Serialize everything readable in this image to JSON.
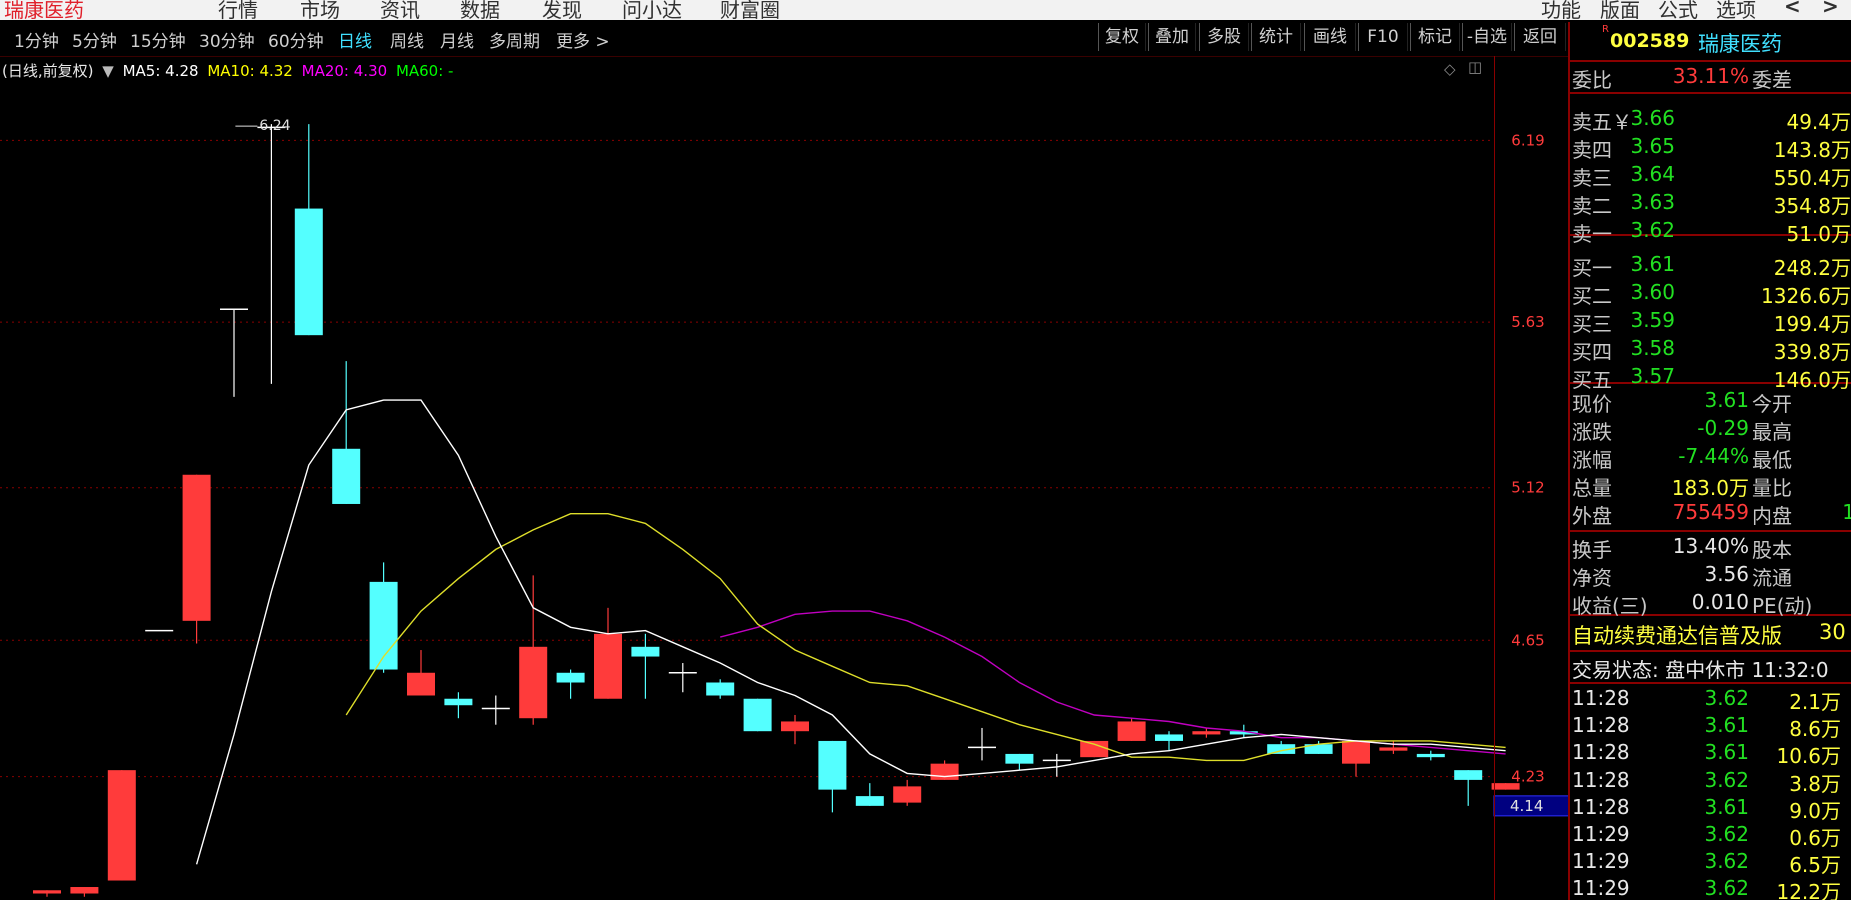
{
  "menubar": {
    "app_title": "瑞康医药",
    "items": [
      "行情",
      "市场",
      "资讯",
      "数据",
      "发现",
      "问小达",
      "财富圈"
    ],
    "right_items": [
      "功能",
      "版面",
      "公式",
      "选项"
    ],
    "nav_back": "<",
    "nav_forward": ">"
  },
  "periods": [
    {
      "label": "1分钟",
      "active": false
    },
    {
      "label": "5分钟",
      "active": false
    },
    {
      "label": "15分钟",
      "active": false
    },
    {
      "label": "30分钟",
      "active": false
    },
    {
      "label": "60分钟",
      "active": false
    },
    {
      "label": "日线",
      "active": true
    },
    {
      "label": "周线",
      "active": false
    },
    {
      "label": "月线",
      "active": false
    },
    {
      "label": "多周期",
      "active": false
    },
    {
      "label": "更多",
      "active": false
    }
  ],
  "more_arrow": ">",
  "tools": [
    "复权",
    "叠加",
    "多股",
    "统计",
    "画线",
    "F10",
    "标记",
    "-自选",
    "返回"
  ],
  "legend": {
    "label": "(日线,前复权)",
    "ma5": "MA5: 4.28",
    "ma10": "MA10: 4.32",
    "ma20": "MA20: 4.30",
    "ma60": "MA60: -",
    "colors": {
      "ma5": "#ffffff",
      "ma10": "#ffff00",
      "ma20": "#ff00ff",
      "ma60": "#00ff00"
    }
  },
  "chart_data": {
    "type": "candlestick",
    "y_ticks": [
      "6.19",
      "5.63",
      "5.12",
      "4.65",
      "4.23"
    ],
    "high_label": "6.24",
    "current_price_tag": "4.14",
    "ylim": [
      3.85,
      6.45
    ],
    "colors": {
      "up": "#ff3b3b",
      "down": "#54ffff",
      "ma5": "#ffffff",
      "ma10": "#dede2a",
      "ma20": "#c000c0"
    },
    "candles": [
      {
        "o": 3.87,
        "c": 3.88,
        "h": 3.88,
        "l": 3.86
      },
      {
        "o": 3.87,
        "c": 3.89,
        "h": 3.89,
        "l": 3.86
      },
      {
        "o": 3.91,
        "c": 4.25,
        "h": 4.25,
        "l": 3.91
      },
      {
        "o": 4.68,
        "c": 4.68,
        "h": 4.68,
        "l": 4.68
      },
      {
        "o": 4.71,
        "c": 5.16,
        "h": 5.16,
        "l": 4.64
      },
      {
        "o": 5.67,
        "c": 5.67,
        "h": 5.67,
        "l": 5.4
      },
      {
        "o": 6.23,
        "c": 6.23,
        "h": 6.24,
        "l": 5.44
      },
      {
        "o": 5.98,
        "c": 5.59,
        "h": 6.24,
        "l": 5.59
      },
      {
        "o": 5.24,
        "c": 5.07,
        "h": 5.51,
        "l": 5.07
      },
      {
        "o": 4.83,
        "c": 4.56,
        "h": 4.89,
        "l": 4.55
      },
      {
        "o": 4.48,
        "c": 4.55,
        "h": 4.62,
        "l": 4.48
      },
      {
        "o": 4.47,
        "c": 4.45,
        "h": 4.49,
        "l": 4.41
      },
      {
        "o": 4.44,
        "c": 4.44,
        "h": 4.48,
        "l": 4.39
      },
      {
        "o": 4.41,
        "c": 4.63,
        "h": 4.85,
        "l": 4.39
      },
      {
        "o": 4.55,
        "c": 4.52,
        "h": 4.56,
        "l": 4.47
      },
      {
        "o": 4.47,
        "c": 4.67,
        "h": 4.75,
        "l": 4.47
      },
      {
        "o": 4.63,
        "c": 4.6,
        "h": 4.67,
        "l": 4.47
      },
      {
        "o": 4.55,
        "c": 4.55,
        "h": 4.58,
        "l": 4.49
      },
      {
        "o": 4.52,
        "c": 4.48,
        "h": 4.53,
        "l": 4.47
      },
      {
        "o": 4.47,
        "c": 4.37,
        "h": 4.47,
        "l": 4.37
      },
      {
        "o": 4.37,
        "c": 4.4,
        "h": 4.42,
        "l": 4.33
      },
      {
        "o": 4.34,
        "c": 4.19,
        "h": 4.34,
        "l": 4.12
      },
      {
        "o": 4.17,
        "c": 4.14,
        "h": 4.21,
        "l": 4.14
      },
      {
        "o": 4.15,
        "c": 4.2,
        "h": 4.22,
        "l": 4.14
      },
      {
        "o": 4.22,
        "c": 4.27,
        "h": 4.28,
        "l": 4.22
      },
      {
        "o": 4.32,
        "c": 4.32,
        "h": 4.38,
        "l": 4.28
      },
      {
        "o": 4.3,
        "c": 4.27,
        "h": 4.3,
        "l": 4.25
      },
      {
        "o": 4.28,
        "c": 4.28,
        "h": 4.3,
        "l": 4.23
      },
      {
        "o": 4.29,
        "c": 4.34,
        "h": 4.34,
        "l": 4.29
      },
      {
        "o": 4.34,
        "c": 4.4,
        "h": 4.41,
        "l": 4.34
      },
      {
        "o": 4.36,
        "c": 4.34,
        "h": 4.37,
        "l": 4.31
      },
      {
        "o": 4.36,
        "c": 4.37,
        "h": 4.38,
        "l": 4.35
      },
      {
        "o": 4.37,
        "c": 4.36,
        "h": 4.39,
        "l": 4.35
      },
      {
        "o": 4.33,
        "c": 4.3,
        "h": 4.34,
        "l": 4.3
      },
      {
        "o": 4.33,
        "c": 4.3,
        "h": 4.34,
        "l": 4.3
      },
      {
        "o": 4.27,
        "c": 4.34,
        "h": 4.34,
        "l": 4.23
      },
      {
        "o": 4.31,
        "c": 4.32,
        "h": 4.34,
        "l": 4.3
      },
      {
        "o": 4.3,
        "c": 4.29,
        "h": 4.31,
        "l": 4.28
      },
      {
        "o": 4.25,
        "c": 4.22,
        "h": 4.25,
        "l": 4.14
      },
      {
        "o": 4.19,
        "c": 4.21,
        "h": 4.21,
        "l": 4.19
      }
    ],
    "ma5": [
      null,
      null,
      null,
      null,
      3.96,
      4.36,
      4.8,
      5.19,
      5.36,
      5.39,
      5.39,
      5.22,
      4.97,
      4.75,
      4.69,
      4.67,
      4.68,
      4.63,
      4.58,
      4.52,
      4.48,
      4.42,
      4.3,
      4.24,
      4.23,
      4.24,
      4.25,
      4.26,
      4.28,
      4.3,
      4.31,
      4.33,
      4.35,
      4.36,
      4.35,
      4.34,
      4.33,
      4.33,
      4.32,
      4.31
    ],
    "ma10": [
      null,
      null,
      null,
      null,
      null,
      null,
      null,
      null,
      4.42,
      4.6,
      4.74,
      4.84,
      4.93,
      4.99,
      5.04,
      5.04,
      5.01,
      4.93,
      4.84,
      4.7,
      4.62,
      4.57,
      4.52,
      4.51,
      4.47,
      4.43,
      4.39,
      4.36,
      4.33,
      4.29,
      4.29,
      4.28,
      4.28,
      4.31,
      4.33,
      4.34,
      4.34,
      4.34,
      4.33,
      4.32
    ],
    "ma20": [
      null,
      null,
      null,
      null,
      null,
      null,
      null,
      null,
      null,
      null,
      null,
      null,
      null,
      null,
      null,
      null,
      null,
      null,
      4.66,
      4.69,
      4.73,
      4.74,
      4.74,
      4.71,
      4.66,
      4.6,
      4.52,
      4.46,
      4.42,
      4.41,
      4.4,
      4.38,
      4.37,
      4.35,
      4.35,
      4.34,
      4.33,
      4.32,
      4.31,
      4.3
    ]
  },
  "quote": {
    "code_prefix": "R",
    "code": "002589",
    "name": "瑞康医药",
    "weibi_label": "委比",
    "weibi": "33.11%",
    "weicha_label": "委差",
    "sells": [
      {
        "label": "卖五￥",
        "price": "3.66",
        "vol": "49.4万"
      },
      {
        "label": "卖四",
        "price": "3.65",
        "vol": "143.8万"
      },
      {
        "label": "卖三",
        "price": "3.64",
        "vol": "550.4万"
      },
      {
        "label": "卖二",
        "price": "3.63",
        "vol": "354.8万"
      },
      {
        "label": "卖一",
        "price": "3.62",
        "vol": "51.0万"
      }
    ],
    "buys": [
      {
        "label": "买一",
        "price": "3.61",
        "vol": "248.2万"
      },
      {
        "label": "买二",
        "price": "3.60",
        "vol": "1326.6万"
      },
      {
        "label": "买三",
        "price": "3.59",
        "vol": "199.4万"
      },
      {
        "label": "买四",
        "price": "3.58",
        "vol": "339.8万"
      },
      {
        "label": "买五",
        "price": "3.57",
        "vol": "146.0万"
      }
    ],
    "stats": [
      {
        "label": "现价",
        "value": "3.61",
        "color": "green",
        "label2": "今开"
      },
      {
        "label": "涨跌",
        "value": "-0.29",
        "color": "green",
        "label2": "最高"
      },
      {
        "label": "涨幅",
        "value": "-7.44%",
        "color": "green",
        "label2": "最低"
      },
      {
        "label": "总量",
        "value": "183.0万",
        "color": "yellow",
        "label2": "量比"
      },
      {
        "label": "外盘",
        "value": "755459",
        "color": "red",
        "label2": "内盘",
        "value2": "1"
      }
    ],
    "stats2": [
      {
        "label": "换手",
        "value": "13.40%",
        "label2": "股本"
      },
      {
        "label": "净资",
        "value": "3.56",
        "label2": "流通"
      },
      {
        "label": "收益(三)",
        "value": "0.010",
        "label2": "PE(动)"
      }
    ],
    "promo": "自动续费通达信普及版",
    "promo_tail": "30",
    "trade_status": "交易状态: 盘中休市 11:32:0",
    "ticks": [
      {
        "time": "11:28",
        "price": "3.62",
        "vol": "2.1万"
      },
      {
        "time": "11:28",
        "price": "3.61",
        "vol": "8.6万"
      },
      {
        "time": "11:28",
        "price": "3.61",
        "vol": "10.6万"
      },
      {
        "time": "11:28",
        "price": "3.62",
        "vol": "3.8万"
      },
      {
        "time": "11:28",
        "price": "3.61",
        "vol": "9.0万"
      },
      {
        "time": "11:29",
        "price": "3.62",
        "vol": "0.6万"
      },
      {
        "time": "11:29",
        "price": "3.62",
        "vol": "6.5万"
      },
      {
        "time": "11:29",
        "price": "3.62",
        "vol": "12.2万"
      }
    ]
  }
}
